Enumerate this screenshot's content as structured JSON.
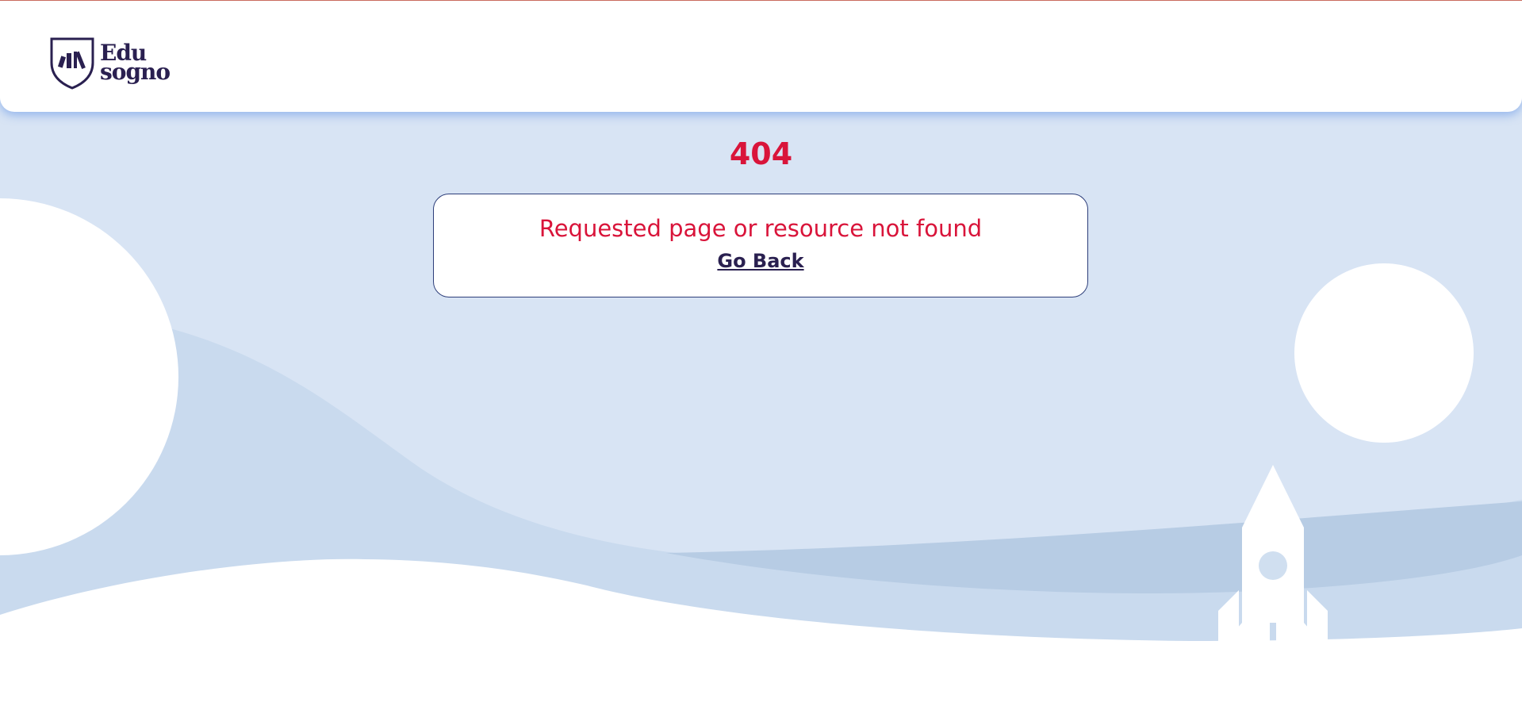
{
  "brand": {
    "logo_line1": "Edu",
    "logo_line2": "sogno",
    "logo_icon": "shield-books-icon"
  },
  "error": {
    "code": "404",
    "message": "Requested page or resource not found",
    "go_back_label": "Go Back"
  },
  "colors": {
    "accent": "#d9143a",
    "brand_dark": "#2a2050",
    "background": "#d8e4f4",
    "header_shadow": "#5a8ce6"
  },
  "illustration": {
    "elements": [
      "planet-left",
      "planet-right",
      "rocket",
      "hills"
    ]
  }
}
